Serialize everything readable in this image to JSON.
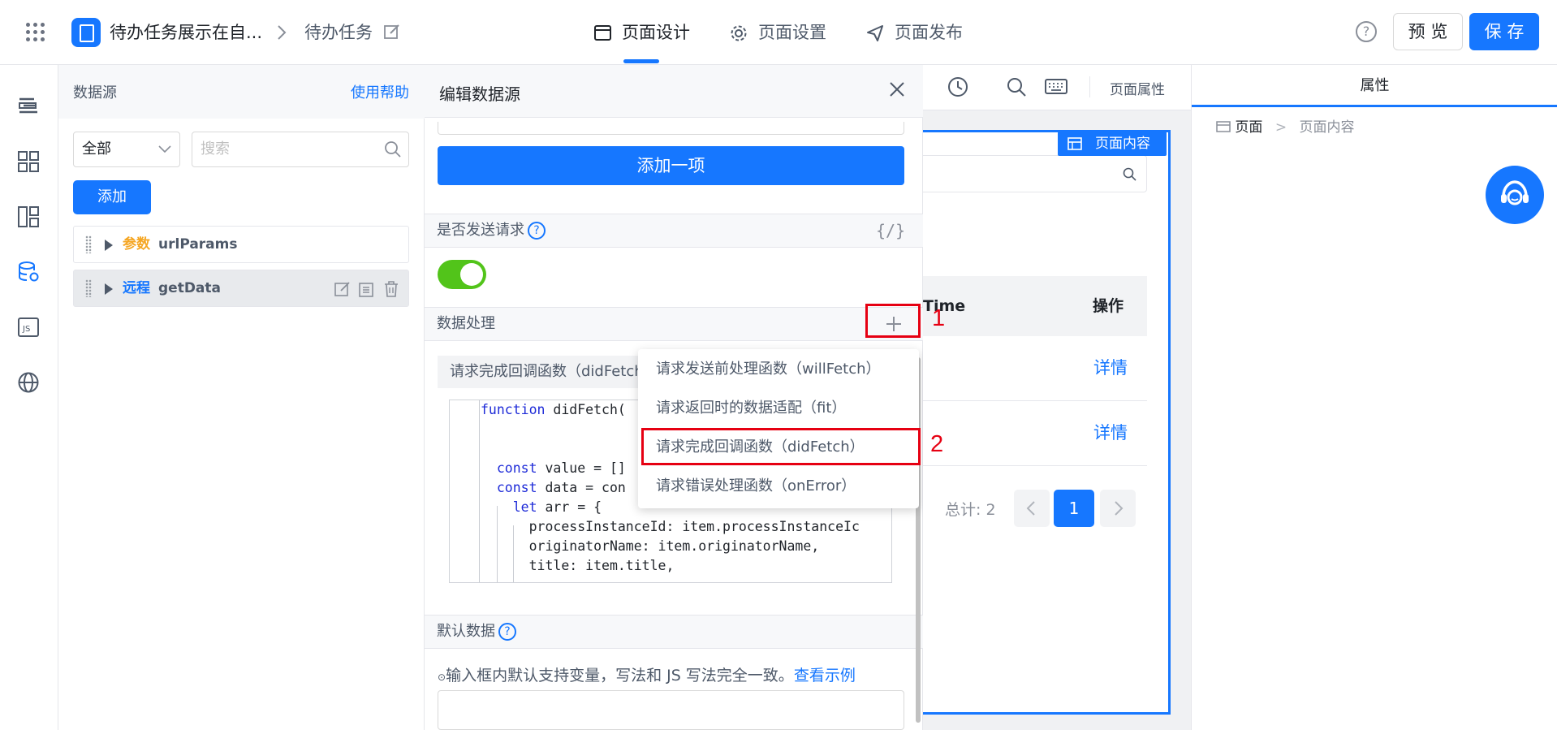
{
  "topbar": {
    "app_name": "待办任务展示在自...",
    "page_name": "待办任务",
    "tabs": [
      {
        "label": "页面设计",
        "icon": "layout-icon"
      },
      {
        "label": "页面设置",
        "icon": "gear-icon"
      },
      {
        "label": "页面发布",
        "icon": "send-icon"
      }
    ],
    "help": "?",
    "preview_label": "预 览",
    "save_label": "保 存"
  },
  "rail": {
    "icons": [
      "outline-icon",
      "components-icon",
      "layout-templates-icon",
      "datasource-icon",
      "js-icon",
      "globe-icon"
    ]
  },
  "datasource": {
    "title": "数据源",
    "help_link": "使用帮助",
    "filter_value": "全部",
    "search_placeholder": "搜索",
    "add_label": "添加",
    "items": [
      {
        "type": "参数",
        "name": "urlParams"
      },
      {
        "type": "远程",
        "name": "getData"
      }
    ]
  },
  "editor": {
    "title": "编辑数据源",
    "add_item_label": "添加一项",
    "send_request_label": "是否发送请求",
    "help_q": "?",
    "code_toggle": "{/}",
    "data_process_label": "数据处理",
    "fn_title": "请求完成回调函数（didFetch",
    "code_lines": [
      "function didFetch(",
      "",
      "  const value = []",
      "  const data = con",
      "    let arr = {",
      "      processInstanceId: item.processInstanceIc",
      "      originatorName: item.originatorName,",
      "      title: item.title,"
    ],
    "default_data_label": "默认数据",
    "hint_text": "输入框内默认支持变量，写法和 JS 写法完全一致。",
    "hint_link": "查看示例"
  },
  "dropdown": {
    "items": [
      "请求发送前处理函数（willFetch）",
      "请求返回时的数据适配（fit）",
      "请求完成回调函数（didFetch）",
      "请求错误处理函数（onError）"
    ]
  },
  "annotations": {
    "step1": "1",
    "step2": "2"
  },
  "canvas": {
    "toolbar_label": "页面属性",
    "content_label": "页面内容",
    "col_time": "Time",
    "col_action": "操作",
    "rows": [
      "详情",
      "详情"
    ],
    "total": "总计: 2",
    "current_page": "1"
  },
  "props": {
    "tab": "属性",
    "crumb_root": "页面",
    "crumb_leaf": "页面内容"
  },
  "colors": {
    "accent": "#1677ff",
    "toggle_on": "#52c41a",
    "annotation_red": "#e60012",
    "param_orange": "#f5a623"
  }
}
